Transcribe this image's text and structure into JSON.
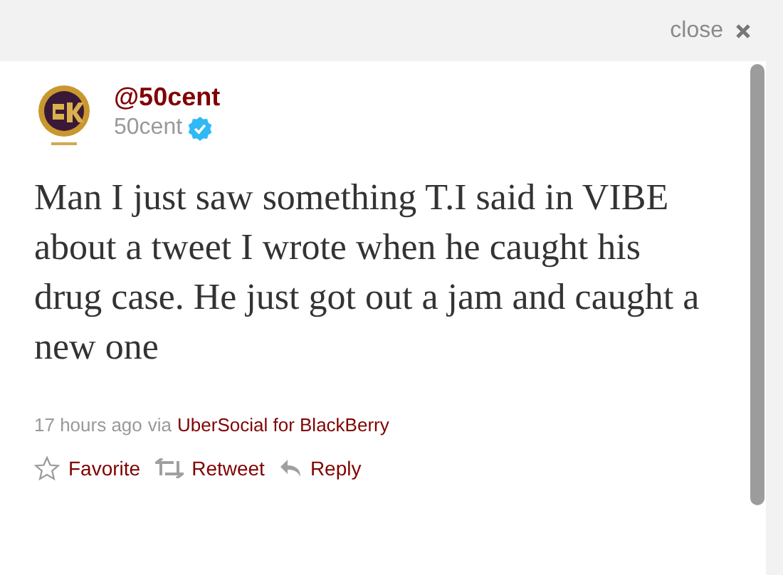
{
  "header": {
    "close_label": "close"
  },
  "tweet": {
    "display_name": "@50cent",
    "username": "50cent",
    "verified": true,
    "text": "Man I just saw something T.I said in VIBE about a tweet I wrote when he caught his drug case. He just got out a jam and caught a new one",
    "time": "17 hours ago",
    "via": "via",
    "source": "UberSocial for BlackBerry"
  },
  "actions": [
    {
      "kind": "favorite",
      "label": "Favorite"
    },
    {
      "kind": "retweet",
      "label": "Retweet"
    },
    {
      "kind": "reply",
      "label": "Reply"
    }
  ]
}
